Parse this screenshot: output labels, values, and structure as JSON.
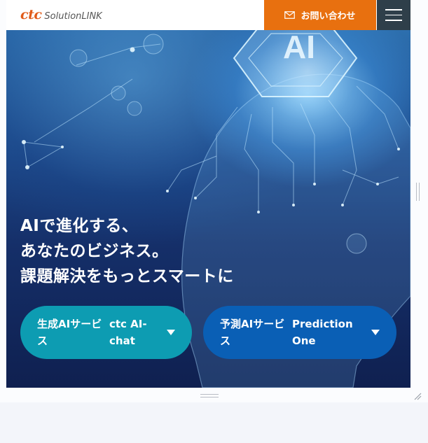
{
  "header": {
    "logo_ctc": "ctc",
    "logo_solution": "SolutionLINK",
    "contact_label": "お問い合わせ",
    "contact_icon": "mail-icon",
    "menu_icon": "hamburger-menu-icon"
  },
  "hero": {
    "headline_lines": [
      "AIで進化する、",
      "あなたのビジネス。",
      "課題解決をもっとスマートに"
    ],
    "services": [
      {
        "label": "生成AIサービス",
        "name": "ctc AI-chat",
        "color": "#0d9cb2"
      },
      {
        "label": "予測AIサービス",
        "name": "Prediction One",
        "color": "#0a5fb5"
      }
    ]
  },
  "colors": {
    "accent_orange": "#e8700f",
    "menu_bg": "#2f3f4a"
  }
}
